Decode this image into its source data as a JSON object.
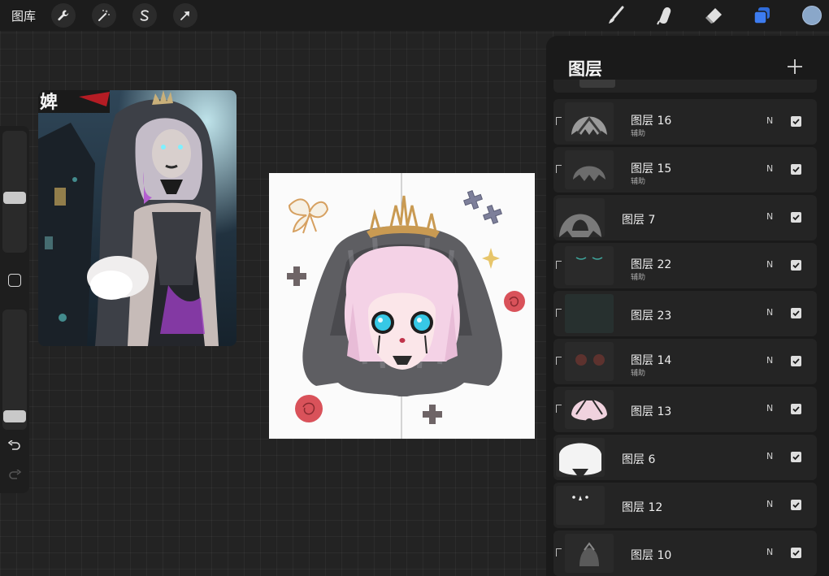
{
  "topbar": {
    "gallery_label": "图库",
    "tools": {
      "actions": "wrench-icon",
      "adjustments": "magic-wand-icon",
      "selection": "selection-s-icon",
      "transform": "arrow-cursor-icon",
      "brush": "brush-icon",
      "smudge": "smudge-finger-icon",
      "eraser": "eraser-icon",
      "layers": "layers-icon",
      "color": "color-swatch"
    },
    "active_color": "#8aa7c9",
    "layers_accent": "#2f6bd8"
  },
  "layers_panel": {
    "title": "图层",
    "add_icon": "plus-icon",
    "layers": [
      {
        "name": "图层 16",
        "sub": "辅助",
        "blend": "N",
        "visible": true,
        "clipped": true
      },
      {
        "name": "图层 15",
        "sub": "辅助",
        "blend": "N",
        "visible": true,
        "clipped": true
      },
      {
        "name": "图层 7",
        "sub": "",
        "blend": "N",
        "visible": true,
        "clipped": false
      },
      {
        "name": "图层 22",
        "sub": "辅助",
        "blend": "N",
        "visible": true,
        "clipped": true
      },
      {
        "name": "图层 23",
        "sub": "",
        "blend": "N",
        "visible": true,
        "clipped": true
      },
      {
        "name": "图层 14",
        "sub": "辅助",
        "blend": "N",
        "visible": true,
        "clipped": true
      },
      {
        "name": "图层 13",
        "sub": "",
        "blend": "N",
        "visible": true,
        "clipped": true
      },
      {
        "name": "图层 6",
        "sub": "",
        "blend": "N",
        "visible": true,
        "clipped": false
      },
      {
        "name": "图层 12",
        "sub": "",
        "blend": "N",
        "visible": true,
        "clipped": false
      },
      {
        "name": "图层 10",
        "sub": "",
        "blend": "N",
        "visible": true,
        "clipped": true
      }
    ]
  },
  "reference": {
    "banner_text": "婢"
  }
}
